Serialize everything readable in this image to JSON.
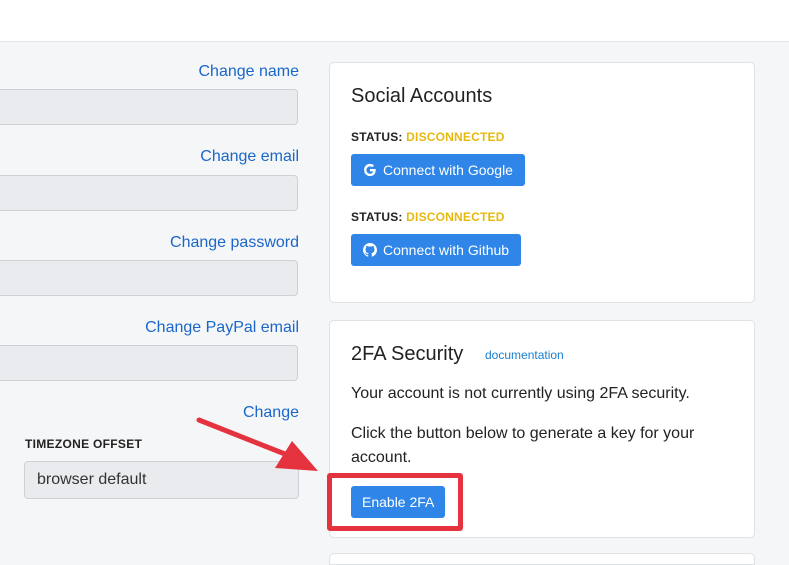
{
  "account": {
    "change_name": "Change name",
    "change_email": "Change email",
    "change_password": "Change password",
    "change_paypal": "Change PayPal email",
    "change_timezone": "Change",
    "timezone_label": "TIMEZONE OFFSET",
    "timezone_value": "browser default"
  },
  "social": {
    "title": "Social Accounts",
    "google": {
      "status_label": "STATUS:",
      "status_value": "DISCONNECTED",
      "button": "Connect with Google"
    },
    "github": {
      "status_label": "STATUS:",
      "status_value": "DISCONNECTED",
      "button": "Connect with Github"
    }
  },
  "twofa": {
    "title": "2FA Security",
    "doc_link": "documentation",
    "para1": "Your account is not currently using 2FA security.",
    "para2_line1": "Click the button below to generate a key for your",
    "para2_line2": "account.",
    "button": "Enable 2FA"
  },
  "colors": {
    "accent": "#2f86e8",
    "link": "#1a66c9",
    "status_warning": "#e8b80c",
    "annotation": "#e5323f"
  }
}
